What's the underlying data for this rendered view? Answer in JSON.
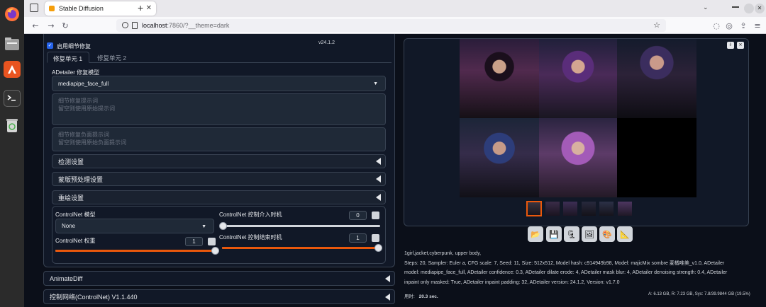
{
  "browser": {
    "tab_title": "Stable Diffusion",
    "tab_close": "✕",
    "new_tab": "+",
    "url_host": "localhost",
    "url_rest": ":7860/?__theme=dark"
  },
  "left": {
    "enable_label": "启用细节修复",
    "version": "v24.1.2",
    "tabs": [
      "修复单元 1",
      "修复单元 2"
    ],
    "model_label": "ADetailer 修复模型",
    "model_value": "mediapipe_face_full",
    "prompt_placeholder": "细节修复提示词\n留空则使用原始提示词",
    "neg_prompt_placeholder": "细节修复负面提示词\n留空则使用原始负面提示词",
    "accordions": [
      "检测设置",
      "蒙版预处理设置",
      "重绘设置"
    ],
    "controlnet_model_label": "ControlNet 模型",
    "controlnet_model_value": "None",
    "controlnet_weight_label": "ControlNet 权重",
    "controlnet_weight_value": "1",
    "controlnet_start_label": "ControlNet 控制介入时机",
    "controlnet_start_value": "0",
    "controlnet_end_label": "ControlNet 控制结束时机",
    "controlnet_end_value": "1",
    "animatediff": "AnimateDiff",
    "controlnet_section": "控制网络(ControlNet) V1.1.440"
  },
  "right": {
    "gallery_buttons": [
      "⇩",
      "✕"
    ],
    "info_line1": "1girl,jacket,cyberpunk, upper body,",
    "info_line2": "Steps: 20, Sampler: Euler a, CFG scale: 7, Seed: 11, Size: 512x512, Model hash: c914949b98, Model: majicMix sombre 麦橘唯美_v1.0, ADetailer",
    "info_line3": "model: mediapipe_face_full, ADetailer confidence: 0.3, ADetailer dilate erode: 4, ADetailer mask blur: 4, ADetailer denoising strength: 0.4, ADetailer",
    "info_line4": "inpaint only masked: True, ADetailer inpaint padding: 32, ADetailer version: 24.1.2, Version: v1.7.0",
    "time_label": "用时:",
    "time_value": "20.3 sec.",
    "vram": "A: 6.13 GB, R: 7.23 GB, Sys: 7.8/39.9844 GB (19.5%)"
  },
  "colors": {
    "accent": "#ea580c",
    "bg": "#0b0f19",
    "panel": "#111827"
  }
}
